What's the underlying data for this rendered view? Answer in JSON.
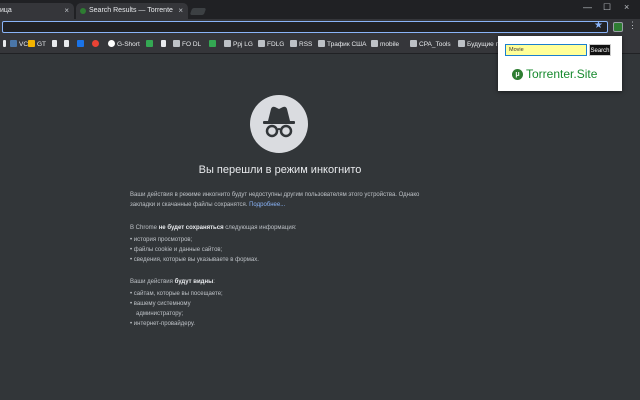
{
  "tabs": [
    {
      "title": "ица",
      "active": false
    },
    {
      "title": "Search Results — Torrente",
      "active": true
    }
  ],
  "window": {
    "close_glyph": "×",
    "minimize_glyph": "—",
    "maximize_glyph": "☐"
  },
  "bookmarks": [
    {
      "label": "VC"
    },
    {
      "label": "GT"
    },
    {
      "label": ""
    },
    {
      "label": ""
    },
    {
      "label": ""
    },
    {
      "label": ""
    },
    {
      "label": "G-Short"
    },
    {
      "label": ""
    },
    {
      "label": ""
    },
    {
      "label": "FO DL"
    },
    {
      "label": ""
    },
    {
      "label": "Ppj LG"
    },
    {
      "label": "FDLG"
    },
    {
      "label": "RSS"
    },
    {
      "label": "Трафик США"
    },
    {
      "label": "mobile"
    },
    {
      "label": "CPA_Tools"
    },
    {
      "label": "Будущие п"
    }
  ],
  "incognito": {
    "title": "Вы перешли в режим инкогнито",
    "para1": "Ваши действия в режиме инкогнито будут недоступны другим пользователям этого устройства. Однако закладки и скачанные файлы сохранятся.",
    "learn_more": "Подробнее...",
    "p2_prefix": "В Chrome ",
    "p2_bold": "не будет сохраняться",
    "p2_suffix": " следующая информация:",
    "list1": [
      "история просмотров;",
      "файлы cookie и данные сайтов;",
      "сведения, которые вы указываете в формах."
    ],
    "p3_prefix": "Ваши действия ",
    "p3_bold": "будут видны",
    "p3_suffix": ":",
    "list2": [
      "сайтам, которые вы посещаете;",
      "вашему системному",
      "администратору;",
      "интернет-провайдеру."
    ]
  },
  "popup": {
    "search_value": "Movie",
    "search_button": "Search",
    "logo_letter": "μ",
    "logo_text": "Torrenter.Site"
  },
  "icons": [
    "close-icon",
    "incognito-icon",
    "star-icon",
    "menu-icon",
    "extension-icon",
    "bookmark-folder-icon"
  ],
  "colors": {
    "accent": "#8ab4f8",
    "brand": "#178a2e",
    "input_bg": "#ffff99"
  }
}
